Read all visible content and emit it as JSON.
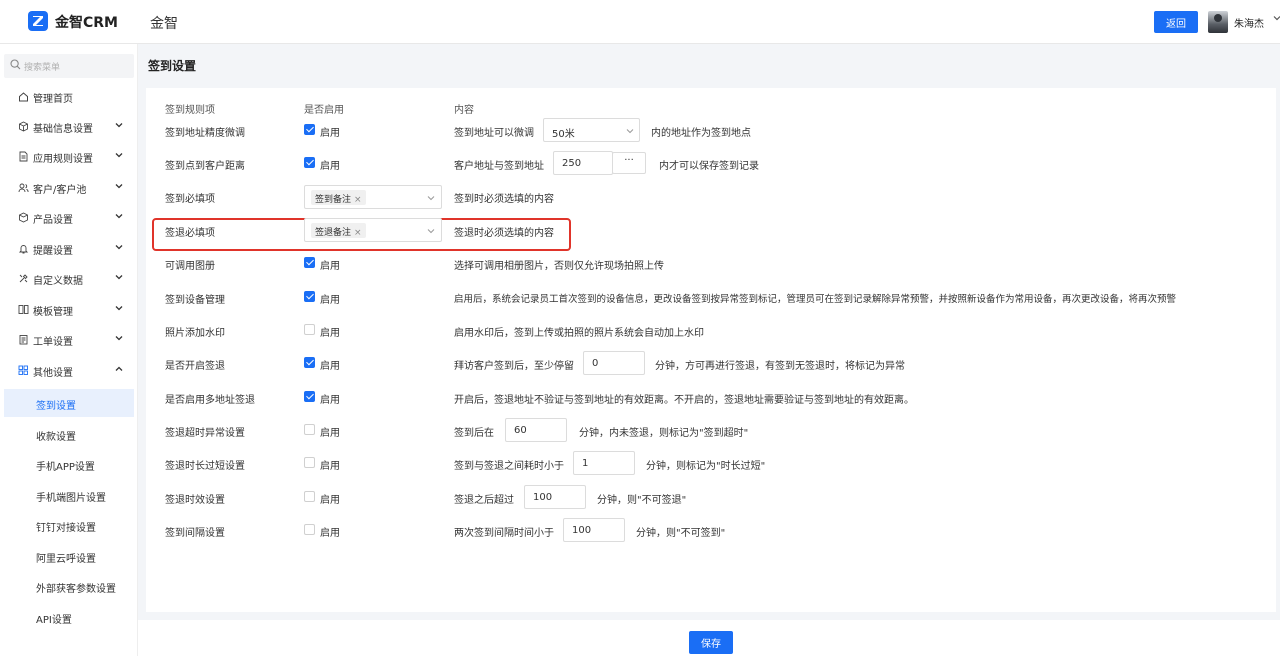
{
  "app": {
    "logo_text": "金智CRM",
    "org_name": "金智",
    "back_label": "返回",
    "user_name": "朱海杰"
  },
  "sidebar": {
    "search_placeholder": "搜索菜单",
    "menu": [
      {
        "label": "管理首页",
        "icon": "home-icon"
      },
      {
        "label": "基础信息设置",
        "icon": "cube-icon"
      },
      {
        "label": "应用规则设置",
        "icon": "document-icon"
      },
      {
        "label": "客户/客户池",
        "icon": "users-icon"
      },
      {
        "label": "产品设置",
        "icon": "box-icon"
      },
      {
        "label": "提醒设置",
        "icon": "bell-icon"
      },
      {
        "label": "自定义数据",
        "icon": "tools-icon"
      },
      {
        "label": "模板管理",
        "icon": "template-icon"
      },
      {
        "label": "工单设置",
        "icon": "clipboard-icon"
      },
      {
        "label": "其他设置",
        "icon": "grid-icon"
      }
    ],
    "sub_items": [
      "签到设置",
      "收款设置",
      "手机APP设置",
      "手机端图片设置",
      "钉钉对接设置",
      "阿里云呼设置",
      "外部获客参数设置",
      "API设置"
    ]
  },
  "page": {
    "title": "签到设置"
  },
  "headers": {
    "rule": "签到规则项",
    "enabled": "是否启用",
    "content": "内容"
  },
  "rows": [
    {
      "label": "签到地址精度微调",
      "enabled": true,
      "cb_label": "启用",
      "pre": "签到地址可以微调",
      "value": "50米",
      "post": "内的地址作为签到地点"
    },
    {
      "label": "签到点到客户距离",
      "enabled": true,
      "cb_label": "启用",
      "pre": "客户地址与签到地址",
      "value": "250",
      "more": "···",
      "post": "内才可以保存签到记录"
    },
    {
      "label": "签到必填项",
      "tag": "签到备注",
      "tag_x": "×",
      "post": "签到时必须选填的内容"
    },
    {
      "label": "签退必填项",
      "tag": "签退备注",
      "tag_x": "×",
      "post": "签退时必须选填的内容"
    },
    {
      "label": "可调用图册",
      "enabled": true,
      "cb_label": "启用",
      "post": "选择可调用相册图片，否则仅允许现场拍照上传"
    },
    {
      "label": "签到设备管理",
      "enabled": true,
      "cb_label": "启用",
      "post": "启用后，系统会记录员工首次签到的设备信息，更改设备签到按异常签到标记，管理员可在签到记录解除异常预警，并按照新设备作为常用设备，再次更改设备，将再次预警"
    },
    {
      "label": "照片添加水印",
      "enabled": false,
      "cb_label": "启用",
      "post": "启用水印后，签到上传或拍照的照片系统会自动加上水印"
    },
    {
      "label": "是否开启签退",
      "enabled": true,
      "cb_label": "启用",
      "pre": "拜访客户签到后，至少停留",
      "value": "0",
      "post": "分钟，方可再进行签退，有签到无签退时，将标记为异常"
    },
    {
      "label": "是否启用多地址签退",
      "enabled": true,
      "cb_label": "启用",
      "post": "开启后，签退地址不验证与签到地址的有效距离。不开启的，签退地址需要验证与签到地址的有效距离。"
    },
    {
      "label": "签退超时异常设置",
      "enabled": false,
      "cb_label": "启用",
      "pre": "签到后在",
      "value": "60",
      "post": "分钟，内未签退，则标记为\"签到超时\""
    },
    {
      "label": "签退时长过短设置",
      "enabled": false,
      "cb_label": "启用",
      "pre": "签到与签退之间耗时小于",
      "value": "1",
      "post": "分钟，则标记为\"时长过短\""
    },
    {
      "label": "签退时效设置",
      "enabled": false,
      "cb_label": "启用",
      "pre": "签退之后超过",
      "value": "100",
      "post": "分钟，则\"不可签退\""
    },
    {
      "label": "签到间隔设置",
      "enabled": false,
      "cb_label": "启用",
      "pre": "两次签到间隔时间小于",
      "value": "100",
      "post": "分钟，则\"不可签到\""
    }
  ],
  "footer": {
    "save_label": "保存"
  },
  "colors": {
    "accent": "#1a6ef5",
    "highlight": "#e0342a"
  }
}
